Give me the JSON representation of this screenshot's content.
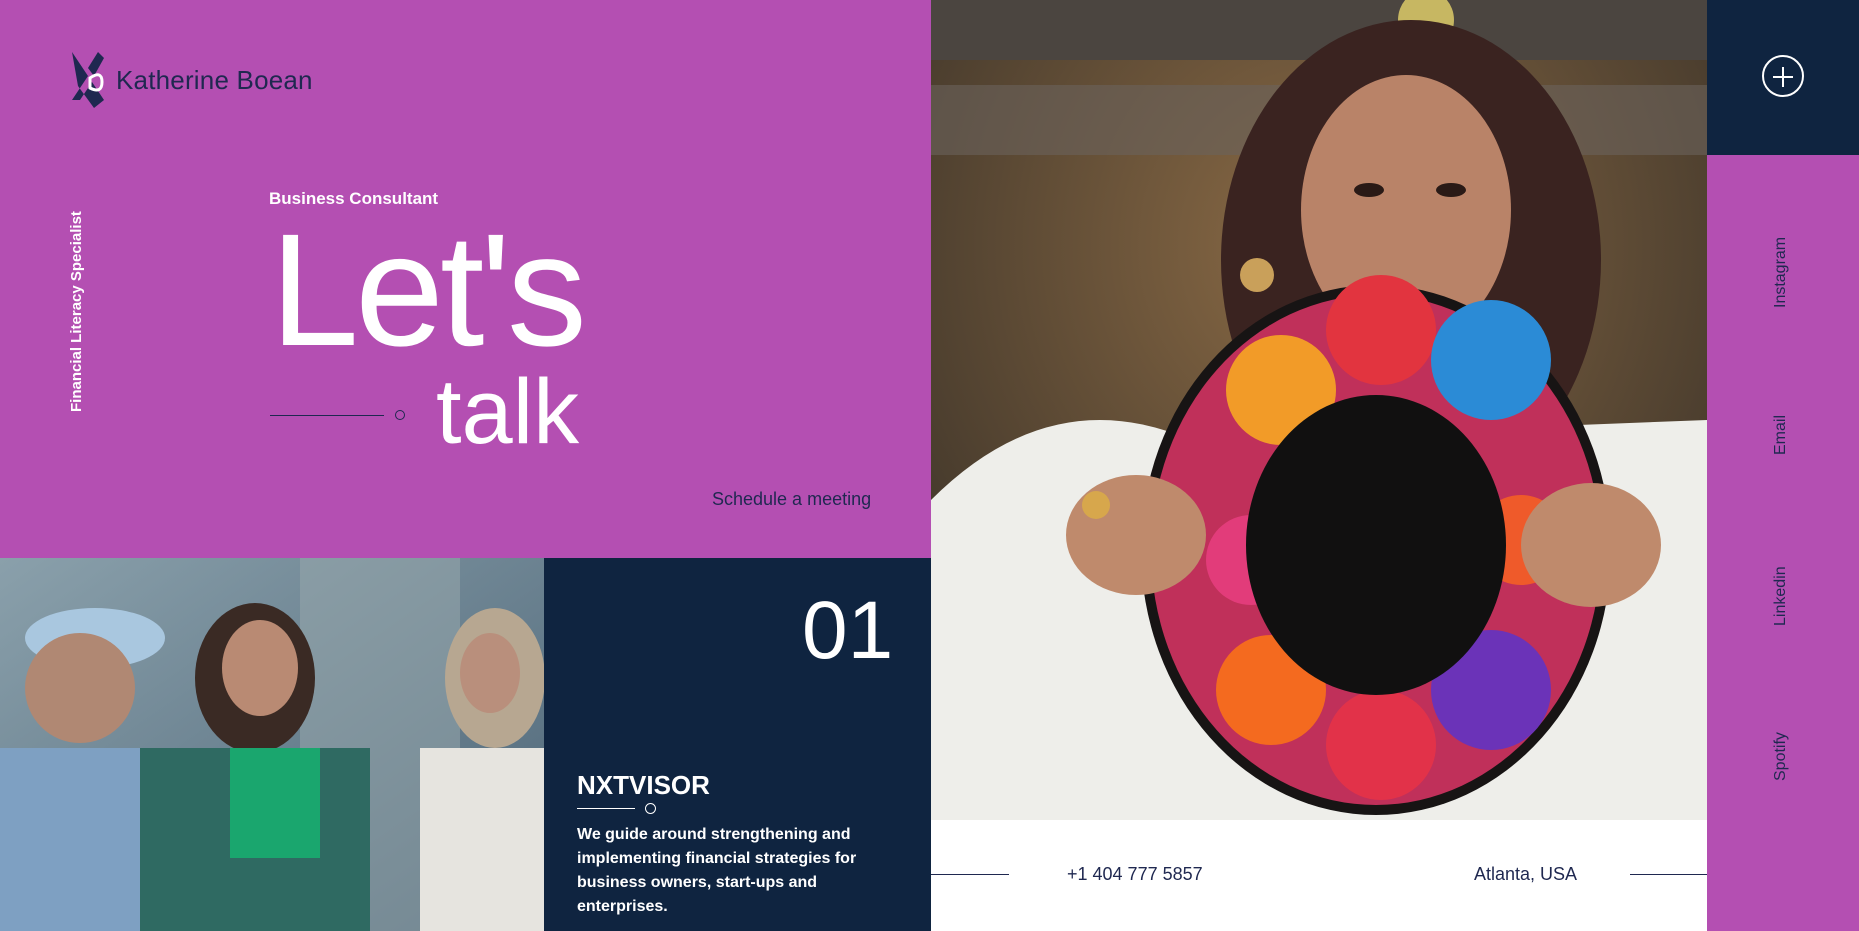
{
  "brand": {
    "name": "Katherine Boean",
    "logo_icon": "kb-logo-icon"
  },
  "hero": {
    "tagline_vertical": "Financial Literacy Specialist",
    "role": "Business Consultant",
    "headline_line1": "Let's",
    "headline_line2": "talk",
    "cta": "Schedule a meeting",
    "bg_color": "#b44fb2"
  },
  "feature": {
    "number": "01",
    "title": "NXTVISOR",
    "description": "We guide around strengthening and implementing financial strategies for business owners, start-ups and enterprises.",
    "bg_color": "#0f2440"
  },
  "contact": {
    "phone": "+1 404 777 5857",
    "location": "Atlanta, USA"
  },
  "social": {
    "menu_icon": "plus-icon",
    "links": [
      {
        "label": "Instagram"
      },
      {
        "label": "Email"
      },
      {
        "label": "Linkedin"
      },
      {
        "label": "Spotify"
      }
    ]
  },
  "colors": {
    "magenta": "#b44fb2",
    "navy": "#0f2440",
    "text_dark": "#1f2850"
  }
}
